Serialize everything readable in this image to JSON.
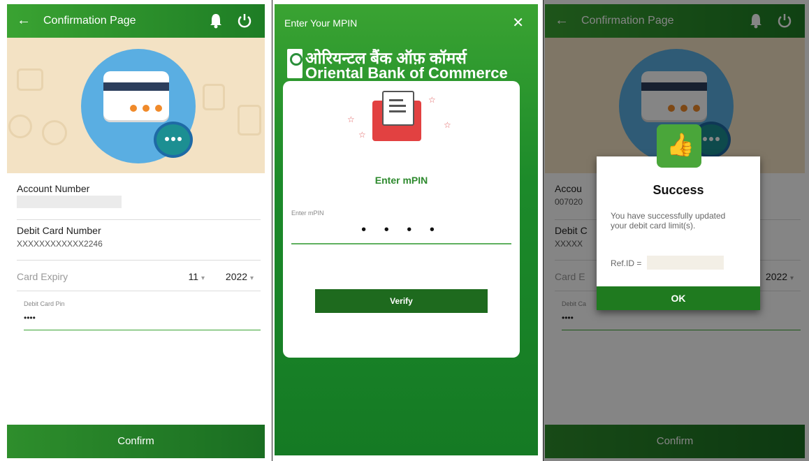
{
  "confirmation": {
    "title": "Confirmation Page",
    "account_label": "Account Number",
    "account_value_partial": "007020",
    "debit_card_label": "Debit Card Number",
    "debit_card_value": "XXXXXXXXXXXX2246",
    "card_expiry_label": "Card Expiry",
    "expiry_month": "11",
    "expiry_year": "2022",
    "debit_pin_label": "Debit Card Pin",
    "debit_pin_value": "••••",
    "confirm_button": "Confirm"
  },
  "mpin": {
    "title": "Enter Your MPIN",
    "bank_name_hindi": "ओरियन्टल बैंक ऑफ़ कॉमर्स",
    "bank_name": "Oriental Bank of Commerce",
    "heading": "Enter mPIN",
    "field_label": "Enter mPIN",
    "field_value": "• • • •",
    "verify_button": "Verify"
  },
  "success": {
    "title": "Success",
    "message": "You have successfully updated your debit card limit(s).",
    "ref_label": "Ref.ID =",
    "ok_button": "OK",
    "bg_account_short": "Accou",
    "bg_debit_short": "Debit C",
    "bg_card_short": "XXXXX",
    "bg_expiry_short": "Card E",
    "bg_pin_short": "Debit Ca"
  },
  "icons": [
    "back-arrow-icon",
    "bell-icon",
    "power-icon",
    "close-icon",
    "envelope-icon",
    "thumbs-up-icon"
  ],
  "colors": {
    "primary": "#2e8e2c",
    "dark_button": "#1e6a1e",
    "hero_bg": "#f3e2c4"
  }
}
